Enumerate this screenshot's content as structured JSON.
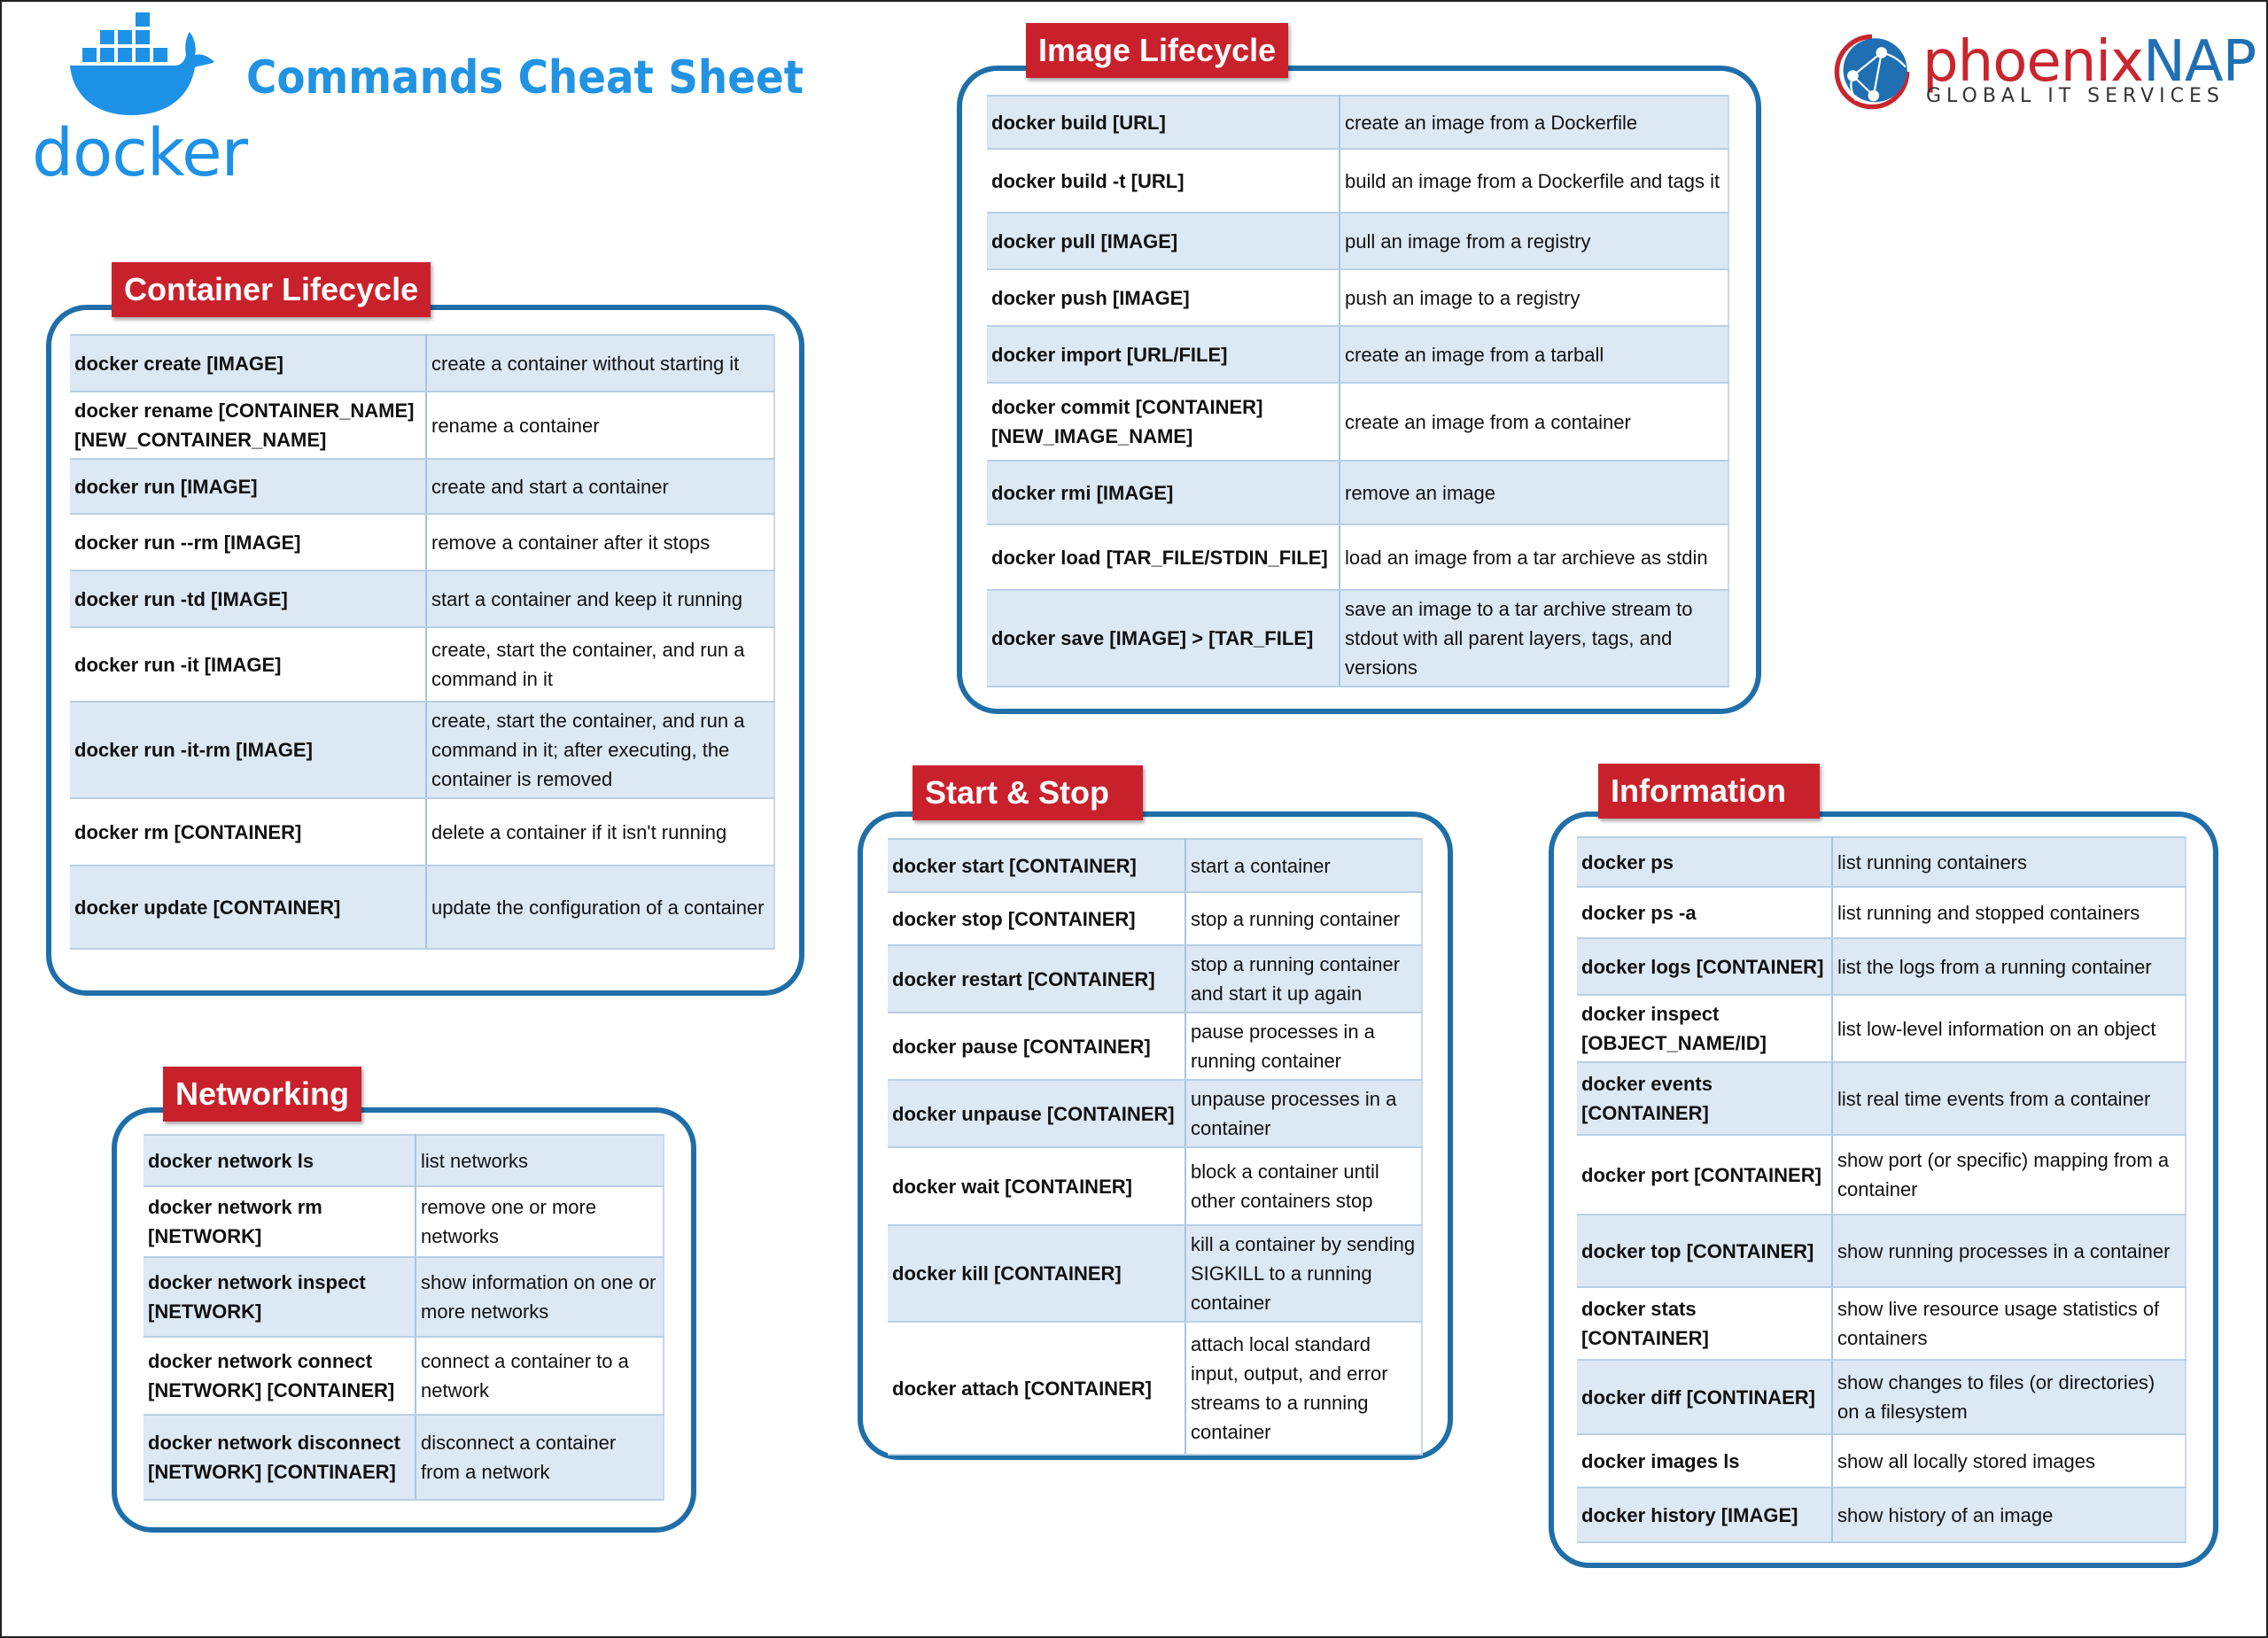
{
  "header": {
    "brand": "docker",
    "title": "Commands Cheat Sheet",
    "partner_name_part1": "phoenix",
    "partner_name_part2": "NAP",
    "partner_tagline": "GLOBAL IT SERVICES"
  },
  "colors": {
    "docker_blue": "#1d91e6",
    "section_border": "#1f6ea8",
    "tag_red": "#c9212b",
    "row_alt": "#dce8f4"
  },
  "sections": {
    "container_lifecycle": {
      "title": "Container Lifecycle",
      "rows": [
        {
          "cmd": "docker create [IMAGE]",
          "desc": "create a container without starting it"
        },
        {
          "cmd": "docker rename [CONTAINER_NAME] [NEW_CONTAINER_NAME]",
          "desc": "rename a container"
        },
        {
          "cmd": "docker run [IMAGE]",
          "desc": "create and start a container"
        },
        {
          "cmd": "docker run --rm [IMAGE]",
          "desc": "remove a container after it stops"
        },
        {
          "cmd": "docker run -td [IMAGE]",
          "desc": "start a container and keep it running"
        },
        {
          "cmd": "docker run -it [IMAGE]",
          "desc": "create, start the container, and run a command in it"
        },
        {
          "cmd": "docker run -it-rm [IMAGE]",
          "desc": "create, start the container, and run a command in it; after executing, the container is removed"
        },
        {
          "cmd": "docker rm [CONTAINER]",
          "desc": "delete a container if it isn't running"
        },
        {
          "cmd": "docker update [CONTAINER]",
          "desc": "update the configuration of a container"
        }
      ]
    },
    "networking": {
      "title": "Networking",
      "rows": [
        {
          "cmd": "docker network ls",
          "desc": "list networks"
        },
        {
          "cmd": "docker network rm [NETWORK]",
          "desc": "remove one or more networks"
        },
        {
          "cmd": "docker network inspect [NETWORK]",
          "desc": "show information on one or more networks"
        },
        {
          "cmd": "docker network connect [NETWORK] [CONTAINER]",
          "desc": "connect a container to a network"
        },
        {
          "cmd": "docker network disconnect [NETWORK] [CONTINAER]",
          "desc": "disconnect a container from a network"
        }
      ]
    },
    "image_lifecycle": {
      "title": "Image Lifecycle",
      "rows": [
        {
          "cmd": "docker build [URL]",
          "desc": "create an image from a Dockerfile"
        },
        {
          "cmd": "docker build -t [URL]",
          "desc": "build an image from a Dockerfile and tags it"
        },
        {
          "cmd": "docker pull [IMAGE]",
          "desc": "pull an image from a registry"
        },
        {
          "cmd": "docker push [IMAGE]",
          "desc": "push an image to a registry"
        },
        {
          "cmd": "docker import [URL/FILE]",
          "desc": "create an image from a tarball"
        },
        {
          "cmd": "docker commit [CONTAINER] [NEW_IMAGE_NAME]",
          "desc": "create an image from a container"
        },
        {
          "cmd": "docker rmi [IMAGE]",
          "desc": "remove an image"
        },
        {
          "cmd": "docker load [TAR_FILE/STDIN_FILE]",
          "desc": "load an image from a tar archieve as stdin"
        },
        {
          "cmd": "docker save [IMAGE] > [TAR_FILE]",
          "desc": "save an image to a tar archive stream to stdout with all parent layers, tags, and versions"
        }
      ]
    },
    "start_stop": {
      "title": "Start & Stop",
      "rows": [
        {
          "cmd": "docker start [CONTAINER]",
          "desc": "start a container"
        },
        {
          "cmd": "docker stop [CONTAINER]",
          "desc": "stop a running container"
        },
        {
          "cmd": "docker restart [CONTAINER]",
          "desc": "stop a running container and start it up again"
        },
        {
          "cmd": "docker pause [CONTAINER]",
          "desc": "pause processes in a running container"
        },
        {
          "cmd": "docker unpause [CONTAINER]",
          "desc": "unpause processes in a container"
        },
        {
          "cmd": "docker wait [CONTAINER]",
          "desc": "block a container until other containers stop"
        },
        {
          "cmd": "docker kill [CONTAINER]",
          "desc": "kill a container by sending SIGKILL to a running container"
        },
        {
          "cmd": "docker attach [CONTAINER]",
          "desc": "attach local standard input, output, and error streams to a running container"
        }
      ]
    },
    "information": {
      "title": "Information",
      "rows": [
        {
          "cmd": "docker ps",
          "desc": "list running containers"
        },
        {
          "cmd": "docker ps -a",
          "desc": "list running and stopped containers"
        },
        {
          "cmd": "docker logs [CONTAINER]",
          "desc": "list the logs from a running container"
        },
        {
          "cmd": "docker inspect [OBJECT_NAME/ID]",
          "desc": "list low-level information on an object"
        },
        {
          "cmd": "docker events [CONTAINER]",
          "desc": "list real time events from a container"
        },
        {
          "cmd": "docker port [CONTAINER]",
          "desc": "show port (or specific) mapping from a container"
        },
        {
          "cmd": "docker top [CONTAINER]",
          "desc": "show running processes in a container"
        },
        {
          "cmd": "docker stats [CONTAINER]",
          "desc": "show live resource usage statistics of containers"
        },
        {
          "cmd": "docker diff [CONTINAER]",
          "desc": "show changes to files (or directories) on a filesystem"
        },
        {
          "cmd": "docker images ls",
          "desc": "show all locally stored images"
        },
        {
          "cmd": "docker history [IMAGE]",
          "desc": "show history of an image"
        }
      ]
    }
  }
}
